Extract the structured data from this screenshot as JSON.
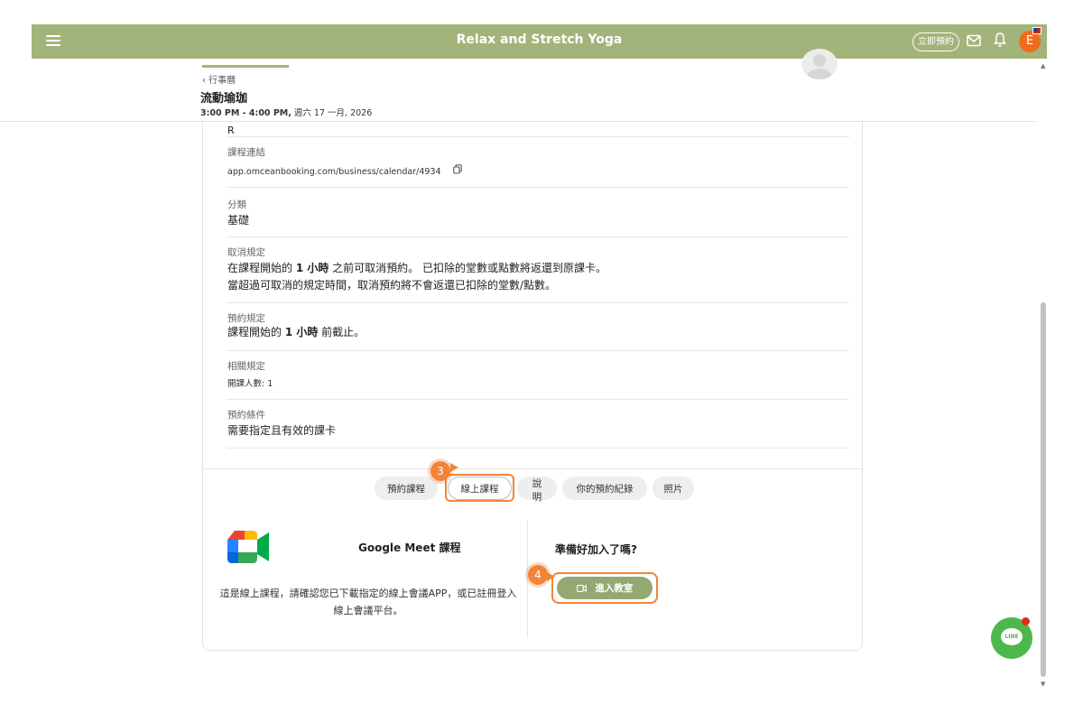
{
  "topbar": {
    "brand": "Relax and Stretch Yoga",
    "book_now_label": "立即預約",
    "avatar_initial": "E",
    "bg_color": "#a3b47a"
  },
  "subheader": {
    "back_label": "‹ 行事曆",
    "title": "流動瑜珈",
    "time_range": "3:00 PM - 4:00 PM,",
    "date": "週六 17 一月, 2026"
  },
  "details": {
    "partial_text": "R",
    "course_link": {
      "label": "課程連結",
      "value": "app.omceanbooking.com/business/calendar/4934"
    },
    "category": {
      "label": "分類",
      "value": "基礎"
    },
    "cancel_policy": {
      "label": "取消規定",
      "line1_prefix": "在課程開始的 ",
      "line1_bold": "1 小時",
      "line1_suffix": " 之前可取消預約。 已扣除的堂數或點數將返還到原課卡。",
      "line2": "當超過可取消的規定時間，取消預約將不會返還已扣除的堂數/點數。"
    },
    "booking_policy": {
      "label": "預約規定",
      "prefix": "課程開始的 ",
      "bold": "1 小時",
      "suffix": " 前截止。"
    },
    "related_rules": {
      "label": "相關規定",
      "value": "開課人數: 1"
    },
    "booking_conditions": {
      "label": "預約條件",
      "value": "需要指定且有效的課卡"
    }
  },
  "tabs": [
    {
      "label": "預約課程",
      "active": false
    },
    {
      "label": "線上課程",
      "active": true
    },
    {
      "label": "說明",
      "active": false
    },
    {
      "label": "你的預約紀錄",
      "active": false
    },
    {
      "label": "照片",
      "active": false
    }
  ],
  "online": {
    "meet_title": "Google Meet 課程",
    "meet_desc": "這是線上課程，請確認您已下載指定的線上會議APP，或已註冊登入線上會議平台。",
    "ready_title": "準備好加入了嗎?",
    "enter_label": "進入教室",
    "enter_icon": "video-camera-icon"
  },
  "annotations": {
    "step3": "3",
    "step4": "4",
    "highlight_color": "#f0853a"
  },
  "floating": {
    "line_label": "LINE"
  }
}
